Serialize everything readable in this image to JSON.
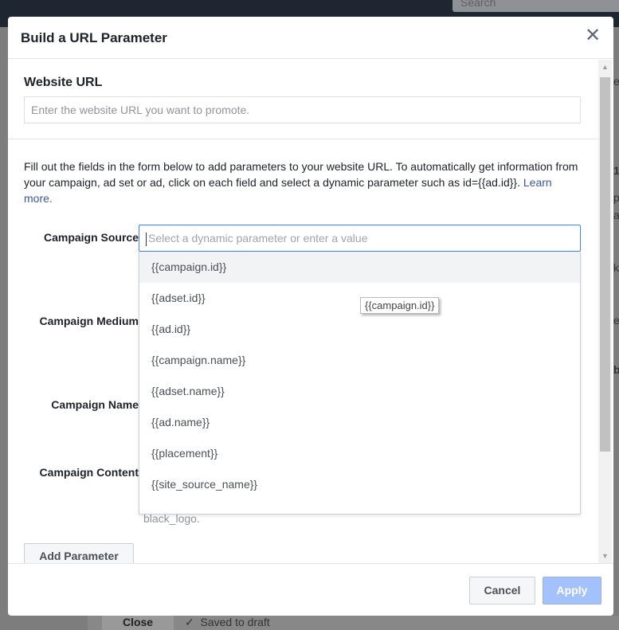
{
  "background": {
    "search_placeholder": "Search",
    "close_label": "Close",
    "saved_status": "Saved to draft",
    "right_fragments": [
      "e",
      "1",
      "pe",
      "a",
      "k",
      "ev",
      "b"
    ]
  },
  "dialog": {
    "title": "Build a URL Parameter",
    "close_icon": "close-x-icon",
    "website_url": {
      "label": "Website URL",
      "placeholder": "Enter the website URL you want to promote."
    },
    "description": "Fill out the fields in the form below to add parameters to your website URL. To automatically get information from your campaign, ad set or ad, click on each field and select a dynamic parameter such as id={{ad.id}}. ",
    "learn_more": "Learn more.",
    "fields": {
      "source": "Campaign Source",
      "medium": "Campaign Medium",
      "name": "Campaign Name",
      "content": "Campaign Content"
    },
    "source_input": {
      "placeholder": "Select a dynamic parameter or enter a value"
    },
    "dropdown_options": [
      "{{campaign.id}}",
      "{{adset.id}}",
      "{{ad.id}}",
      "{{campaign.name}}",
      "{{adset.name}}",
      "{{ad.name}}",
      "{{placement}}",
      "{{site_source_name}}"
    ],
    "highlighted_option": "{{campaign.id}}",
    "tooltip": "{{campaign.id}}",
    "content_hint": "black_logo.",
    "add_parameter": "Add Parameter",
    "cancel": "Cancel",
    "apply": "Apply",
    "colors": {
      "focus_border": "#4080ff",
      "link": "#385898",
      "apply_disabled": "#a3c1fa"
    }
  }
}
